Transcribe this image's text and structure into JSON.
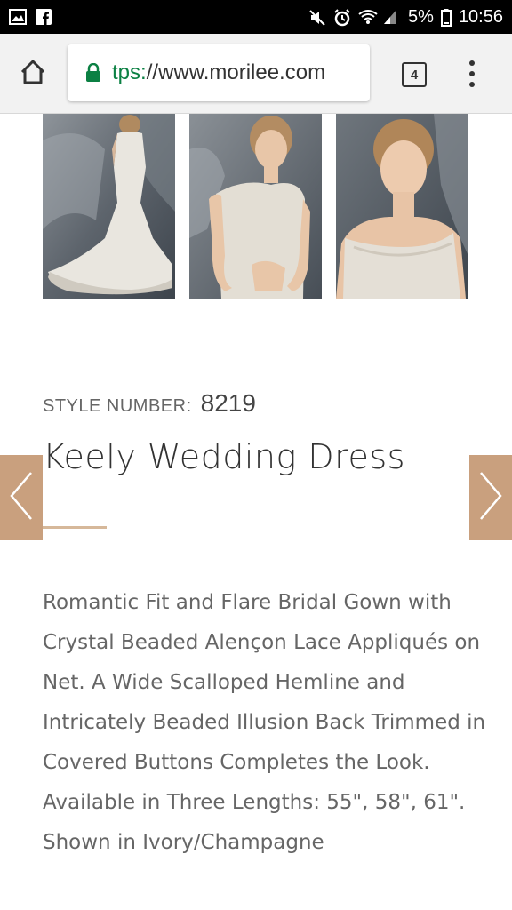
{
  "status_bar": {
    "battery": "5%",
    "time": "10:56",
    "left_icons": [
      "image-icon",
      "facebook-icon"
    ],
    "right_icons": [
      "mute-icon",
      "alarm-icon",
      "wifi-icon",
      "signal-icon",
      "battery-icon"
    ]
  },
  "browser": {
    "url_scheme": "tps:",
    "url_rest": "//www.morilee.com",
    "tab_count": "4"
  },
  "product": {
    "style_label": "STYLE NUMBER:",
    "style_number": "8219",
    "title": "Keely Wedding Dress",
    "description": "Romantic Fit and Flare Bridal Gown with Crystal Beaded Alençon Lace Appliqués on Net. A Wide Scalloped Hemline and Intricately Beaded Illusion Back Trimmed in Covered Buttons Completes the Look. Available in Three Lengths: 55\", 58\", 61\". Shown in Ivory/Champagne"
  },
  "colors": {
    "accent": "#c9a07e",
    "rule": "#d6b89a",
    "secure": "#0b8043"
  }
}
